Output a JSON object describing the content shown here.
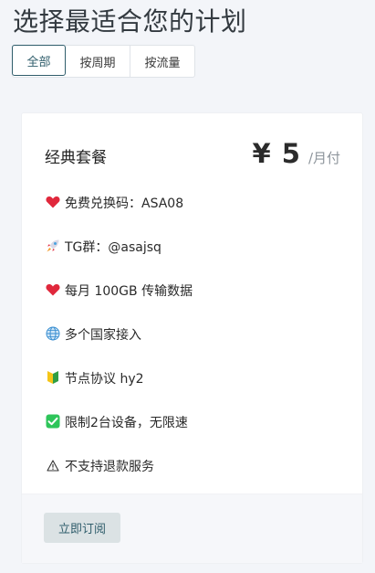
{
  "page": {
    "title": "选择最适合您的计划"
  },
  "tabs": [
    {
      "label": "全部",
      "active": true
    },
    {
      "label": "按周期",
      "active": false
    },
    {
      "label": "按流量",
      "active": false
    }
  ],
  "plan": {
    "name": "经典套餐",
    "price": "¥ 5",
    "period": "/月付",
    "features": [
      {
        "icon": "heart-icon",
        "text": "免费兑换码：ASA08"
      },
      {
        "icon": "rocket-icon",
        "text": "TG群：@asajsq"
      },
      {
        "icon": "heart-icon",
        "text": "每月 100GB 传输数据"
      },
      {
        "icon": "globe-icon",
        "text": "多个国家接入"
      },
      {
        "icon": "beginner-icon",
        "text": "节点协议 hy2"
      },
      {
        "icon": "check-mark-icon",
        "text": "限制2台设备，无限速"
      },
      {
        "icon": "warning-icon",
        "text": "不支持退款服务"
      }
    ],
    "subscribe_label": "立即订阅"
  },
  "colors": {
    "accent": "#2f5d6b",
    "button_bg": "#dbe2e4",
    "background": "#f3f5f9"
  }
}
